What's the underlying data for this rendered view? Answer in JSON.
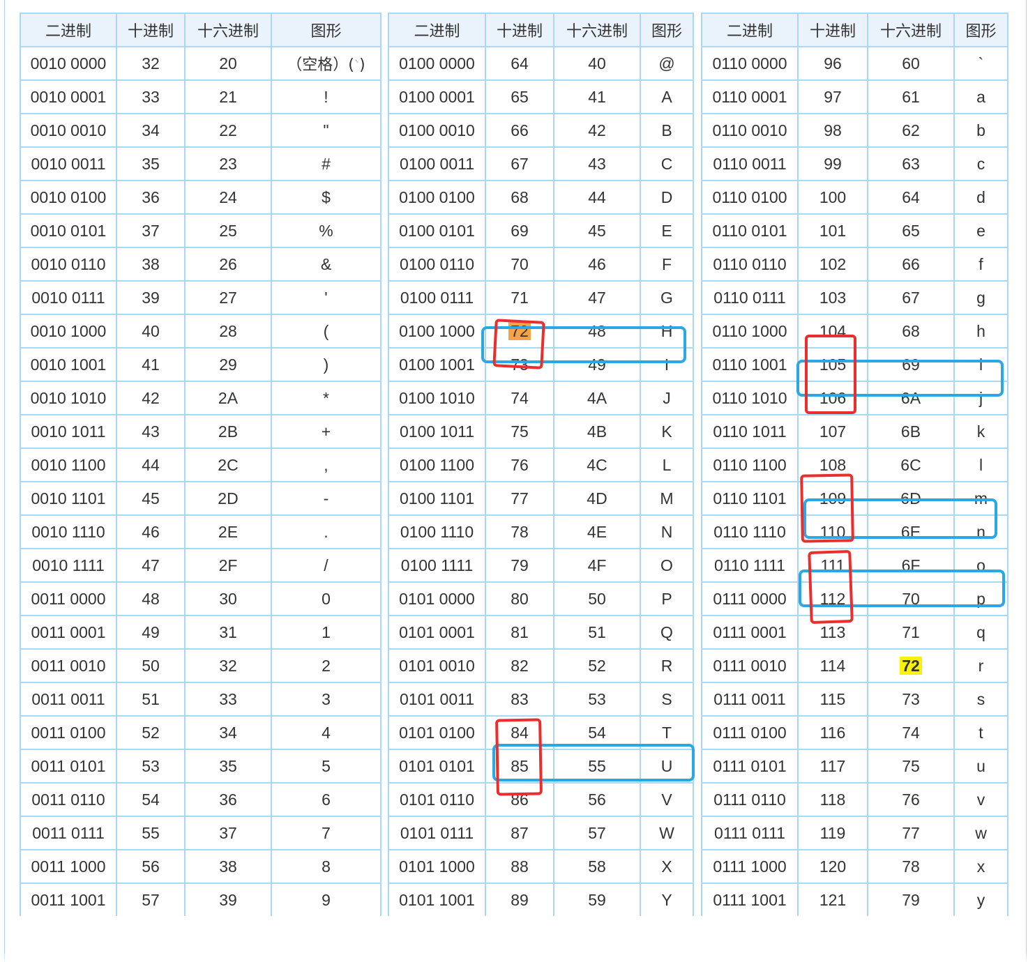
{
  "headers": [
    "二进制",
    "十进制",
    "十六进制",
    "图形"
  ],
  "space_label": "（空格）(",
  "space_sub": "␠",
  "space_close": ")",
  "table_1": [
    [
      "0010 0000",
      "32",
      "20",
      ""
    ],
    [
      "0010 0001",
      "33",
      "21",
      "!"
    ],
    [
      "0010 0010",
      "34",
      "22",
      "\""
    ],
    [
      "0010 0011",
      "35",
      "23",
      "#"
    ],
    [
      "0010 0100",
      "36",
      "24",
      "$"
    ],
    [
      "0010 0101",
      "37",
      "25",
      "%"
    ],
    [
      "0010 0110",
      "38",
      "26",
      "&"
    ],
    [
      "0010 0111",
      "39",
      "27",
      "'"
    ],
    [
      "0010 1000",
      "40",
      "28",
      "("
    ],
    [
      "0010 1001",
      "41",
      "29",
      ")"
    ],
    [
      "0010 1010",
      "42",
      "2A",
      "*"
    ],
    [
      "0010 1011",
      "43",
      "2B",
      "+"
    ],
    [
      "0010 1100",
      "44",
      "2C",
      ","
    ],
    [
      "0010 1101",
      "45",
      "2D",
      "-"
    ],
    [
      "0010 1110",
      "46",
      "2E",
      "."
    ],
    [
      "0010 1111",
      "47",
      "2F",
      "/"
    ],
    [
      "0011 0000",
      "48",
      "30",
      "0"
    ],
    [
      "0011 0001",
      "49",
      "31",
      "1"
    ],
    [
      "0011 0010",
      "50",
      "32",
      "2"
    ],
    [
      "0011 0011",
      "51",
      "33",
      "3"
    ],
    [
      "0011 0100",
      "52",
      "34",
      "4"
    ],
    [
      "0011 0101",
      "53",
      "35",
      "5"
    ],
    [
      "0011 0110",
      "54",
      "36",
      "6"
    ],
    [
      "0011 0111",
      "55",
      "37",
      "7"
    ],
    [
      "0011 1000",
      "56",
      "38",
      "8"
    ],
    [
      "0011 1001",
      "57",
      "39",
      "9"
    ]
  ],
  "table_2": [
    [
      "0100 0000",
      "64",
      "40",
      "@"
    ],
    [
      "0100 0001",
      "65",
      "41",
      "A"
    ],
    [
      "0100 0010",
      "66",
      "42",
      "B"
    ],
    [
      "0100 0011",
      "67",
      "43",
      "C"
    ],
    [
      "0100 0100",
      "68",
      "44",
      "D"
    ],
    [
      "0100 0101",
      "69",
      "45",
      "E"
    ],
    [
      "0100 0110",
      "70",
      "46",
      "F"
    ],
    [
      "0100 0111",
      "71",
      "47",
      "G"
    ],
    [
      "0100 1000",
      "72",
      "48",
      "H"
    ],
    [
      "0100 1001",
      "73",
      "49",
      "I"
    ],
    [
      "0100 1010",
      "74",
      "4A",
      "J"
    ],
    [
      "0100 1011",
      "75",
      "4B",
      "K"
    ],
    [
      "0100 1100",
      "76",
      "4C",
      "L"
    ],
    [
      "0100 1101",
      "77",
      "4D",
      "M"
    ],
    [
      "0100 1110",
      "78",
      "4E",
      "N"
    ],
    [
      "0100 1111",
      "79",
      "4F",
      "O"
    ],
    [
      "0101 0000",
      "80",
      "50",
      "P"
    ],
    [
      "0101 0001",
      "81",
      "51",
      "Q"
    ],
    [
      "0101 0010",
      "82",
      "52",
      "R"
    ],
    [
      "0101 0011",
      "83",
      "53",
      "S"
    ],
    [
      "0101 0100",
      "84",
      "54",
      "T"
    ],
    [
      "0101 0101",
      "85",
      "55",
      "U"
    ],
    [
      "0101 0110",
      "86",
      "56",
      "V"
    ],
    [
      "0101 0111",
      "87",
      "57",
      "W"
    ],
    [
      "0101 1000",
      "88",
      "58",
      "X"
    ],
    [
      "0101 1001",
      "89",
      "59",
      "Y"
    ]
  ],
  "table_3": [
    [
      "0110 0000",
      "96",
      "60",
      "`"
    ],
    [
      "0110 0001",
      "97",
      "61",
      "a"
    ],
    [
      "0110 0010",
      "98",
      "62",
      "b"
    ],
    [
      "0110 0011",
      "99",
      "63",
      "c"
    ],
    [
      "0110 0100",
      "100",
      "64",
      "d"
    ],
    [
      "0110 0101",
      "101",
      "65",
      "e"
    ],
    [
      "0110 0110",
      "102",
      "66",
      "f"
    ],
    [
      "0110 0111",
      "103",
      "67",
      "g"
    ],
    [
      "0110 1000",
      "104",
      "68",
      "h"
    ],
    [
      "0110 1001",
      "105",
      "69",
      "i"
    ],
    [
      "0110 1010",
      "106",
      "6A",
      "j"
    ],
    [
      "0110 1011",
      "107",
      "6B",
      "k"
    ],
    [
      "0110 1100",
      "108",
      "6C",
      "l"
    ],
    [
      "0110 1101",
      "109",
      "6D",
      "m"
    ],
    [
      "0110 1110",
      "110",
      "6E",
      "n"
    ],
    [
      "0110 1111",
      "111",
      "6F",
      "o"
    ],
    [
      "0111 0000",
      "112",
      "70",
      "p"
    ],
    [
      "0111 0001",
      "113",
      "71",
      "q"
    ],
    [
      "0111 0010",
      "114",
      "72",
      "r"
    ],
    [
      "0111 0011",
      "115",
      "73",
      "s"
    ],
    [
      "0111 0100",
      "116",
      "74",
      "t"
    ],
    [
      "0111 0101",
      "117",
      "75",
      "u"
    ],
    [
      "0111 0110",
      "118",
      "76",
      "v"
    ],
    [
      "0111 0111",
      "119",
      "77",
      "w"
    ],
    [
      "0111 1000",
      "120",
      "78",
      "x"
    ],
    [
      "0111 1001",
      "121",
      "79",
      "y"
    ]
  ],
  "highlights": {
    "orange_cell": {
      "table": 2,
      "row": 8,
      "col": 1
    },
    "yellow_cell": {
      "table": 3,
      "row": 18,
      "col": 2
    },
    "orange_color": "#f5a346",
    "yellow_color": "#fbf20c"
  },
  "annotation_colors": {
    "red": "#ec2d2d",
    "blue": "#2aa8e6"
  }
}
